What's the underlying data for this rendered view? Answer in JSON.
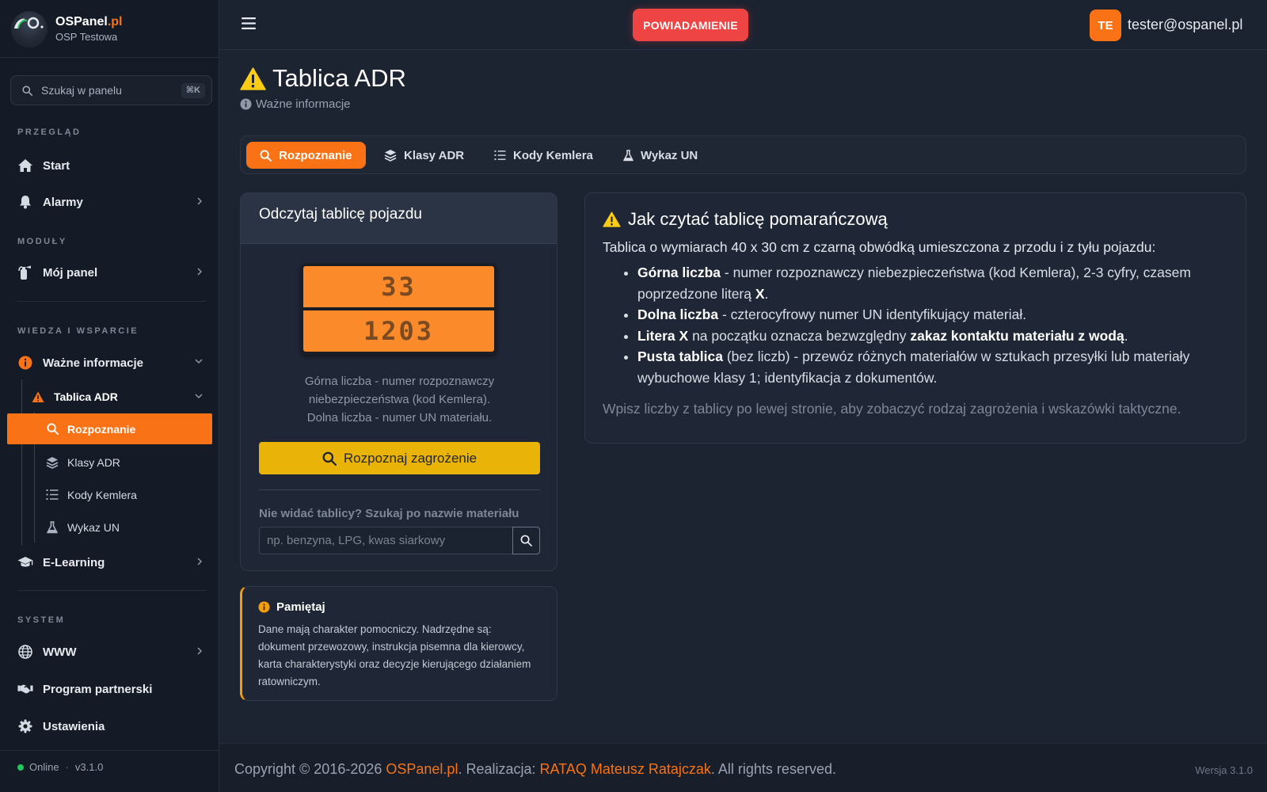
{
  "colors": {
    "accent": "#f97316",
    "danger": "#ef4444",
    "warning": "#eab308",
    "online": "#22c55e",
    "sidebar_bg": "#151b26",
    "page_bg": "#1c2331"
  },
  "brand": {
    "name_main": "OSPanel",
    "name_tld": ".pl",
    "subtitle": "OSP Testowa"
  },
  "sidebar": {
    "search": {
      "placeholder": "Szukaj w panelu",
      "shortcut": "⌘K",
      "icon": "search-icon"
    },
    "sections": {
      "overview": "PRZEGLĄD",
      "modules": "MODUŁY",
      "knowledge": "WIEDZA I WSPARCIE",
      "system": "SYSTEM"
    },
    "items": {
      "start": {
        "label": "Start",
        "icon": "home-icon"
      },
      "alarms": {
        "label": "Alarmy",
        "icon": "bell-icon"
      },
      "my_panel": {
        "label": "Mój panel",
        "icon": "fire-extinguisher-icon"
      },
      "important_info": {
        "label": "Ważne informacje",
        "icon": "info-icon"
      },
      "adr_board": {
        "label": "Tablica ADR",
        "icon": "warning-icon"
      },
      "recognition": {
        "label": "Rozpoznanie",
        "icon": "search-icon"
      },
      "adr_classes": {
        "label": "Klasy ADR",
        "icon": "layers-icon"
      },
      "kemler_codes": {
        "label": "Kody Kemlera",
        "icon": "list-ol-icon"
      },
      "un_list": {
        "label": "Wykaz UN",
        "icon": "flask-icon"
      },
      "elearning": {
        "label": "E-Learning",
        "icon": "graduation-cap-icon"
      },
      "www": {
        "label": "WWW",
        "icon": "globe-icon"
      },
      "partner": {
        "label": "Program partnerski",
        "icon": "handshake-icon"
      },
      "settings": {
        "label": "Ustawienia",
        "icon": "gear-icon"
      }
    },
    "footer": {
      "status": "Online",
      "separator": "·",
      "version": "v3.1.0"
    }
  },
  "topbar": {
    "notification_label": "POWIADAMIENIE",
    "user_initials": "TE",
    "user_email": "tester@ospanel.pl"
  },
  "page": {
    "title": "Tablica ADR",
    "breadcrumb": "Ważne informacje"
  },
  "tabs": [
    {
      "label": "Rozpoznanie",
      "icon": "search-icon",
      "active": true
    },
    {
      "label": "Klasy ADR",
      "icon": "layers-icon",
      "active": false
    },
    {
      "label": "Kody Kemlera",
      "icon": "list-ol-icon",
      "active": false
    },
    {
      "label": "Wykaz UN",
      "icon": "flask-icon",
      "active": false
    }
  ],
  "plate_card": {
    "title": "Odczytaj tablicę pojazdu",
    "plate_top": "33",
    "plate_bottom": "1203",
    "caption_line1": "Górna liczba - numer rozpoznawczy",
    "caption_line2": "niebezpieczeństwa (kod Kemlera).",
    "caption_line3": "Dolna liczba - numer UN materiału.",
    "recognize_button": "Rozpoznaj zagrożenie",
    "search_label": "Nie widać tablicy? Szukaj po nazwie materiału",
    "search_placeholder": "np. benzyna, LPG, kwas siarkowy"
  },
  "notice": {
    "title": "Pamiętaj",
    "body": "Dane mają charakter pomocniczy. Nadrzędne są: dokument przewozowy, instrukcja pisemna dla kierowcy, karta charakterystyki oraz decyzje kierującego działaniem ratowniczym."
  },
  "info_card": {
    "title": "Jak czytać tablicę pomarańczową",
    "intro": "Tablica o wymiarach 40 x 30 cm z czarną obwódką umieszczona z przodu i z tyłu pojazdu:",
    "items": [
      {
        "bold": "Górna liczba",
        "text": " - numer rozpoznawczy niebezpieczeństwa (kod Kemlera), 2-3 cyfry, czasem poprzedzone literą ",
        "bold2": "X",
        "tail": "."
      },
      {
        "bold": "Dolna liczba",
        "text": " - czterocyfrowy numer UN identyfikujący materiał.",
        "bold2": "",
        "tail": ""
      },
      {
        "bold": "Litera X",
        "text": " na początku oznacza bezwzględny ",
        "bold2": "zakaz kontaktu materiału z wodą",
        "tail": "."
      },
      {
        "bold": "Pusta tablica",
        "text": " (bez liczb) - przewóz różnych materiałów w sztukach przesyłki lub materiały wybuchowe klasy 1; identyfikacja z dokumentów.",
        "bold2": "",
        "tail": ""
      }
    ],
    "hint": "Wpisz liczby z tablicy po lewej stronie, aby zobaczyć rodzaj zagrożenia i wskazówki taktyczne."
  },
  "footer": {
    "prefix": "Copyright © 2016-2026 ",
    "brand_link": "OSPanel.pl",
    "middle": ". Realizacja: ",
    "author_link": "RATAQ Mateusz Ratajczak",
    "suffix": ". All rights reserved.",
    "version": "Wersja 3.1.0"
  }
}
